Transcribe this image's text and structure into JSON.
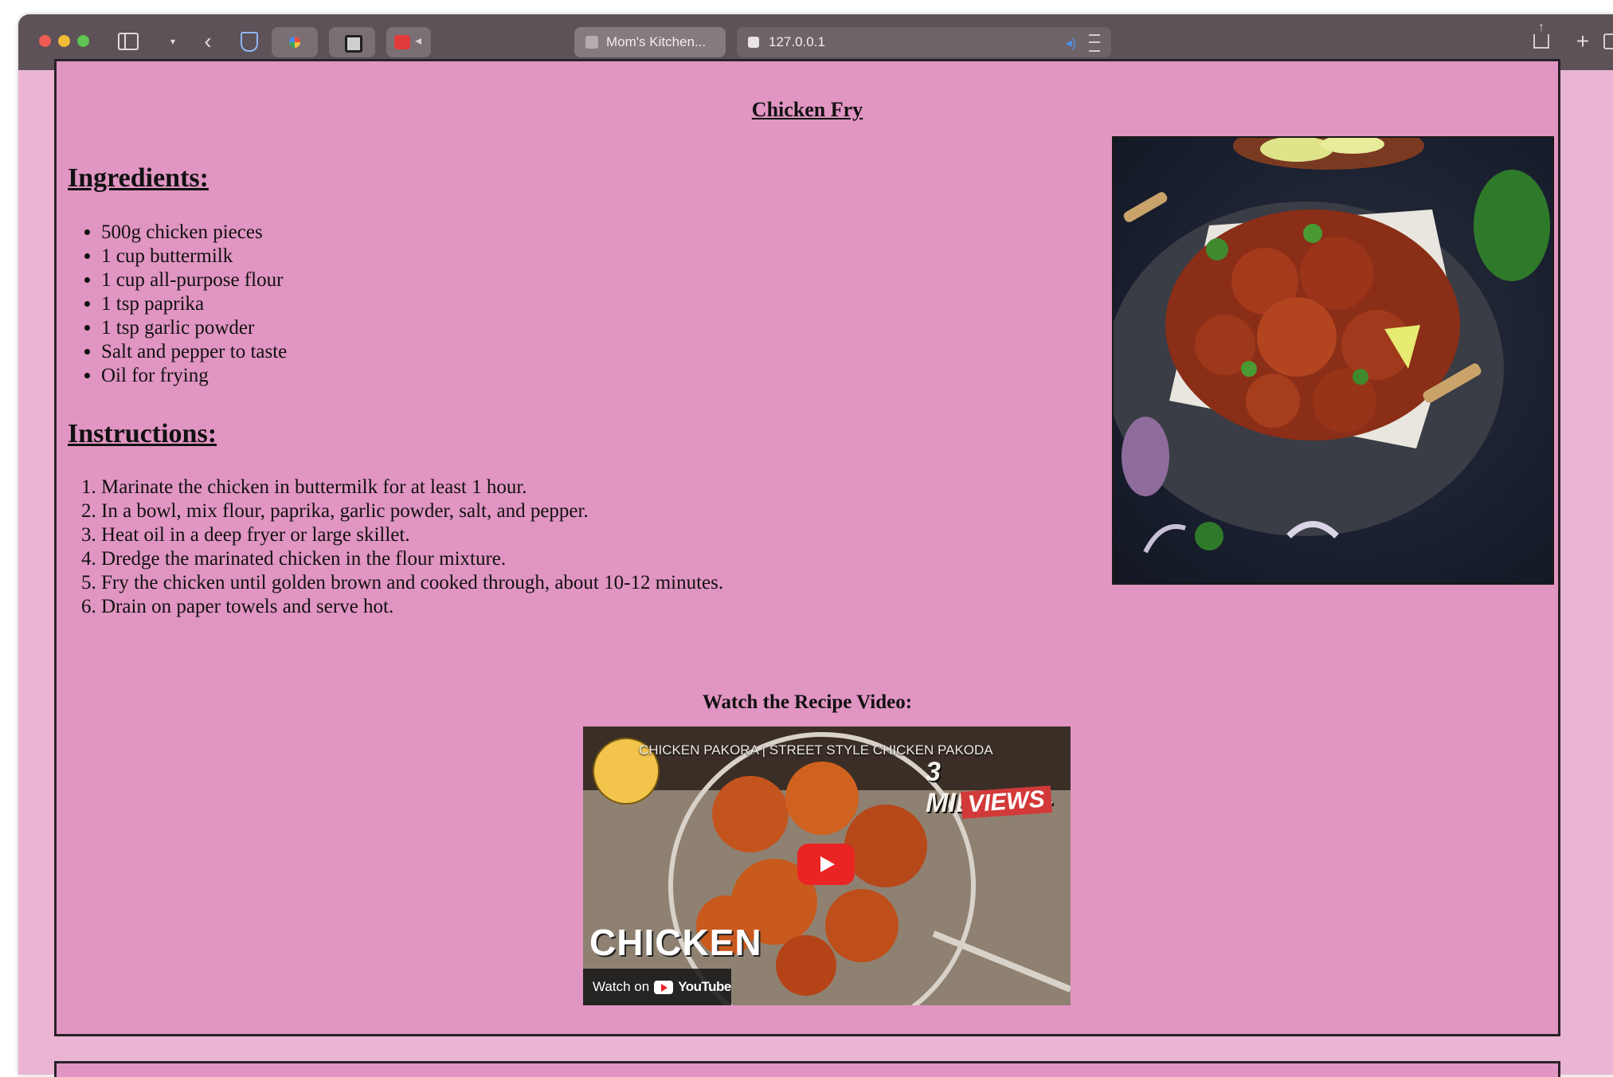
{
  "browser": {
    "tab_title": "Mom's Kitchen...",
    "url": "127.0.0.1",
    "new_tab_symbol": "+",
    "back_symbol": "‹"
  },
  "recipe": {
    "title": "Chicken Fry",
    "ingredients_heading": "Ingredients:",
    "ingredients": [
      "500g chicken pieces",
      "1 cup buttermilk",
      "1 cup all-purpose flour",
      "1 tsp paprika",
      "1 tsp garlic powder",
      "Salt and pepper to taste",
      "Oil for frying"
    ],
    "instructions_heading": "Instructions:",
    "instructions": [
      "Marinate the chicken in buttermilk for at least 1 hour.",
      "In a bowl, mix flour, paprika, garlic powder, salt, and pepper.",
      "Heat oil in a deep fryer or large skillet.",
      "Dredge the marinated chicken in the flour mixture.",
      "Fry the chicken until golden brown and cooked through, about 10-12 minutes.",
      "Drain on paper towels and serve hot."
    ]
  },
  "video": {
    "heading": "Watch the Recipe Video:",
    "title": "CHICKEN PAKORA | STREET STYLE CHICKEN PAKODA",
    "views_big": "3 MILLION+",
    "views_sub": "VIEWS",
    "caption": "CHICKEN",
    "watch_on": "Watch on",
    "platform": "YouTube"
  },
  "colors": {
    "page_background": "#e195c2",
    "window_background": "#e9b5d3",
    "toolbar": "#5d5257",
    "play_button": "#ea2323"
  }
}
